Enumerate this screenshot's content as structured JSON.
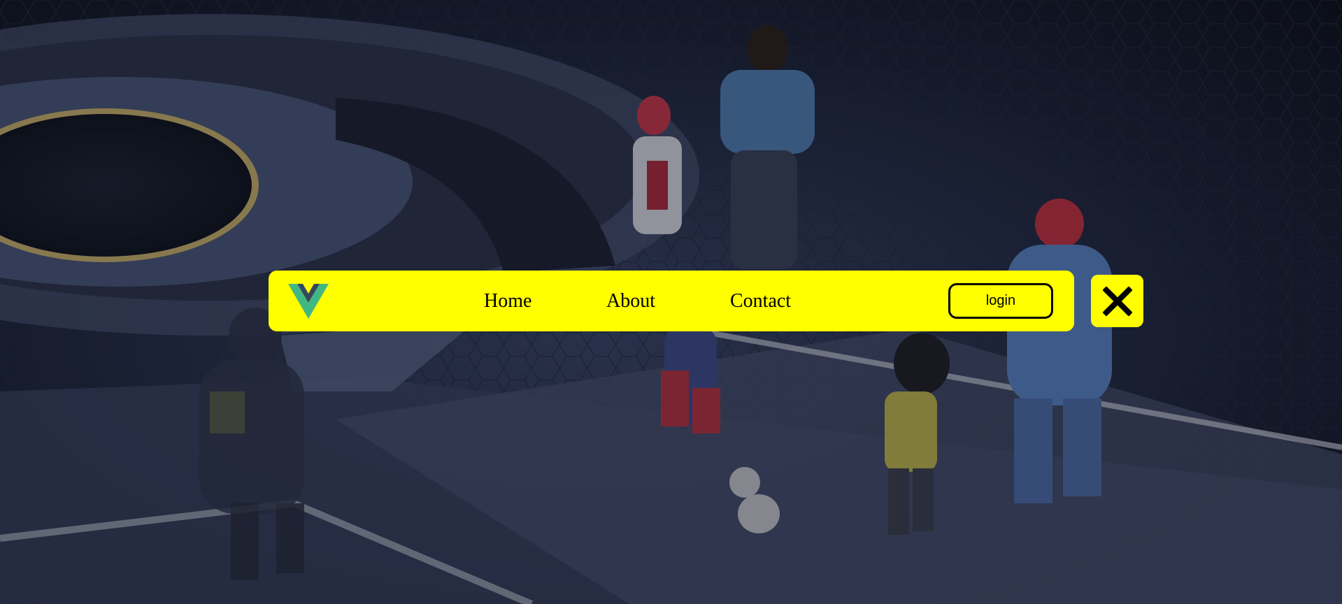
{
  "nav": {
    "logo_icon": "vue-logo-icon",
    "links": [
      {
        "label": "Home"
      },
      {
        "label": "About"
      },
      {
        "label": "Contact"
      }
    ],
    "login_label": "login",
    "background_color": "#ffff00"
  },
  "close_icon": "close-icon",
  "colors": {
    "accent": "#ffff00",
    "logo_primary": "#41b883",
    "logo_secondary": "#34495e"
  }
}
